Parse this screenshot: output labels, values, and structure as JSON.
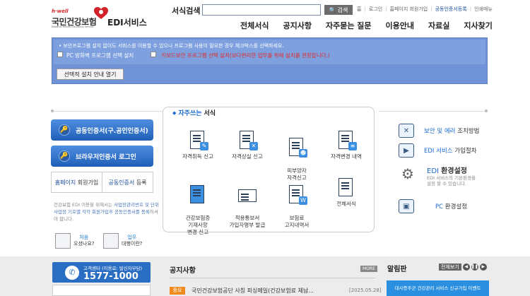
{
  "logo": {
    "hwell": "h·well",
    "korean_name": "국민건강보험",
    "english_name": "National Health Insurance Service",
    "service": "EDI서비스"
  },
  "search": {
    "label": "서식검색",
    "button_label": "검색",
    "value": ""
  },
  "util_links": [
    "홈",
    "로그인",
    "홈페이지 회원가입",
    "공동인증서등록",
    "인쇄매뉴"
  ],
  "gnb": [
    "전체서식",
    "공지사항",
    "자주묻는 질문",
    "이용안내",
    "자료실",
    "지사찾기"
  ],
  "install_box": {
    "text": "• 보안프로그램 설치 없이도 서비스를 이용할 수 있으나 프로그램 사용이 필요한 경우 체크박스를 선택하세요.",
    "option1": "PC 방화벽 프로그램 선택 설치",
    "option2": "키보드보안 프로그램 선택 설치(보다편리한 업무를 위해 설치를 권장합니다.)",
    "guide_button": "선택적 설치 안내 열기"
  },
  "left": {
    "cert_login": "공동인증서(구.공인인증서)",
    "browser_cert_login": "브라우저인증서 로그인",
    "signup_blue": "홈페이지",
    "signup_rest": "회원가입",
    "cert_reg_blue": "공동인증서",
    "cert_reg_rest": "등록",
    "desc_part1": "건강보험 EDI 이용을 위해서는 ",
    "desc_blue1": "사업장관리번호 및 단위 사업장 기호별 각각 회원가입후 공동인증서를 등록",
    "desc_part2": "하셔야 합니다.",
    "first_visit_top": "처음",
    "first_visit_bottom": "오셨나요?",
    "agent_top": "업무",
    "agent_bottom": "대행이란?"
  },
  "forms": {
    "title_blue": "자주쓰는",
    "title_rest": "서식",
    "items": [
      {
        "label": "자격취득 신고",
        "icon": "document-pen-icon"
      },
      {
        "label": "자격상실 신고",
        "icon": "document-x-icon"
      },
      {
        "label": "피부양자\n자격신고",
        "icon": "document-person-icon"
      },
      {
        "label": "자격변경 내역",
        "icon": "monitor-doc-icon"
      },
      {
        "label": "건강보험증\n기재사항\n변경 신고",
        "icon": "insurance-card-icon"
      },
      {
        "label": "적용통보서\n가입자명부 발급",
        "icon": "printer-icon"
      },
      {
        "label": "보험료\n고지내역서",
        "icon": "calculator-icon"
      },
      {
        "label": "전체서식",
        "icon": "stack-docs-icon"
      }
    ]
  },
  "right": {
    "error_blue": "보안 및 에러",
    "error_rest": "조치방법",
    "edi_signup_blue": "EDI 서비스",
    "edi_signup_rest": "가입절차",
    "env_blue": "EDI",
    "env_rest": "환경설정",
    "env_desc": "EDI 서비스의 기본환경을\n설정 할 수 있습니다.",
    "pc_blue": "PC",
    "pc_rest": "환경설정"
  },
  "bottom": {
    "call_center_label": "고객센터 (이용료: 발신자부담)",
    "call_center_number": "1577-1000",
    "notice_title": "공지사항",
    "more": "MORE",
    "notice_tag": "중요",
    "notice_item": "국민건강보험공단 사칭 피싱메일(건강보험료 체납...",
    "notice_date": "[2025.05.28]",
    "alarm_title": "알림판",
    "alarm_viewall": "전체보기",
    "banner_text": "대사증후군 건강관리 서비스 신규가입 이벤트"
  }
}
